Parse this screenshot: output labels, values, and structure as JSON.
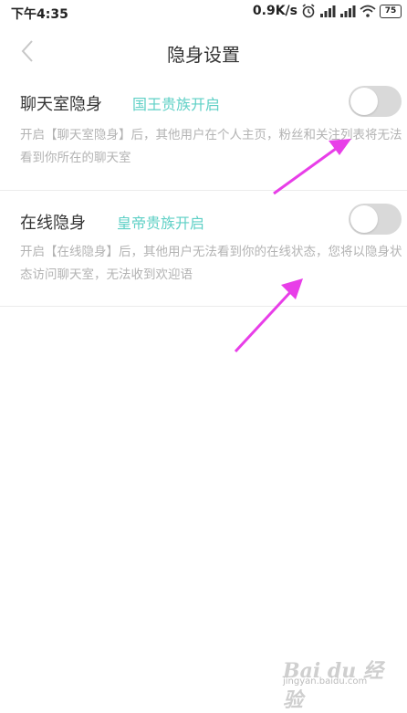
{
  "status_bar": {
    "time": "下午4:35",
    "network_speed": "0.9K/s",
    "battery_level": "75",
    "icons": [
      "alarm-icon",
      "signal-icon",
      "signal-icon",
      "wifi-icon",
      "battery-icon"
    ]
  },
  "nav": {
    "title": "隐身设置",
    "back_icon": "chevron-left-icon"
  },
  "settings": [
    {
      "title": "聊天室隐身",
      "badge": "国王贵族开启",
      "description": "开启【聊天室隐身】后，其他用户在个人主页，粉丝和关注列表将无法看到你所在的聊天室",
      "enabled": false
    },
    {
      "title": "在线隐身",
      "badge": "皇帝贵族开启",
      "description": "开启【在线隐身】后，其他用户无法看到你的在线状态，您将以隐身状态访问聊天室，无法收到欢迎语",
      "enabled": false
    }
  ],
  "colors": {
    "badge": "#5fd0c6",
    "toggle_off": "#d9d9d9",
    "arrow": "#e83ee8"
  },
  "watermark": {
    "logo": "Bai du 经验",
    "url": "jingyan.baidu.com"
  }
}
